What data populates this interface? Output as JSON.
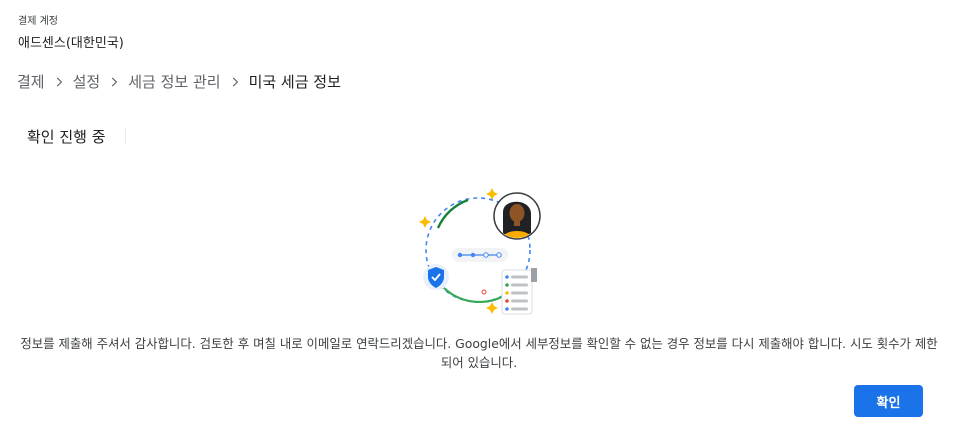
{
  "account": {
    "label": "결제 계정",
    "name": "애드센스(대한민국)"
  },
  "breadcrumb": {
    "items": [
      "결제",
      "설정",
      "세금 정보 관리",
      "미국 세금 정보"
    ],
    "separator_icon": "chevron-right-icon"
  },
  "section": {
    "title": "확인 진행 중"
  },
  "illustration": {
    "icons": [
      "person-avatar",
      "shield-check-icon",
      "sparkle-icon",
      "progress-dots",
      "document-list"
    ]
  },
  "message": {
    "text": "정보를 제출해 주셔서 감사합니다. 검토한 후 며칠 내로 이메일로 연락드리겠습니다. Google에서 세부정보를 확인할 수 없는 경우 정보를 다시 제출해야 합니다. 시도 횟수가 제한되어 있습니다."
  },
  "actions": {
    "confirm_label": "확인"
  },
  "colors": {
    "primary": "#1a73e8",
    "text": "#202124",
    "muted": "#5f6368",
    "green": "#34a853",
    "yellow": "#fbbc04",
    "red": "#ea4335"
  }
}
